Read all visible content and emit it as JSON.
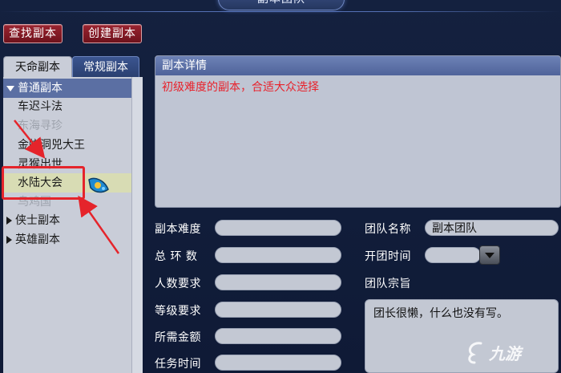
{
  "window": {
    "title": "副本团队"
  },
  "toolbar": {
    "find_label": "查找副本",
    "create_label": "创建副本"
  },
  "tabs": [
    {
      "label": "天命副本"
    },
    {
      "label": "常规副本"
    }
  ],
  "tree": {
    "groups": [
      {
        "label": "普通副本",
        "expanded": true,
        "items": [
          "车迟斗法",
          "东海寻珍",
          "金蝉洞兕大王",
          "灵猴出世",
          "水陆大会",
          "鸟鸡国"
        ]
      },
      {
        "label": "侠士副本",
        "expanded": false
      },
      {
        "label": "英雄副本",
        "expanded": false
      }
    ],
    "selected": "水陆大会"
  },
  "detail": {
    "header": "副本详情",
    "description": "初级难度的副本，合适大众选择"
  },
  "form": {
    "difficulty_label": "副本难度",
    "rings_label": "总 环 数",
    "people_label": "人数要求",
    "level_label": "等级要求",
    "money_label": "所需金额",
    "time_label": "任务时间",
    "team_name_label": "团队名称",
    "team_name_value": "副本团队",
    "open_time_label": "开团时间",
    "purpose_label": "团队宗旨",
    "purpose_value": "团长很懒，什么也没有写。"
  },
  "watermark": {
    "text": "九游"
  },
  "colors": {
    "accent_red": "#e5242b",
    "panel_bg": "#c9cdd8",
    "header_blue": "#5b6fa3"
  }
}
